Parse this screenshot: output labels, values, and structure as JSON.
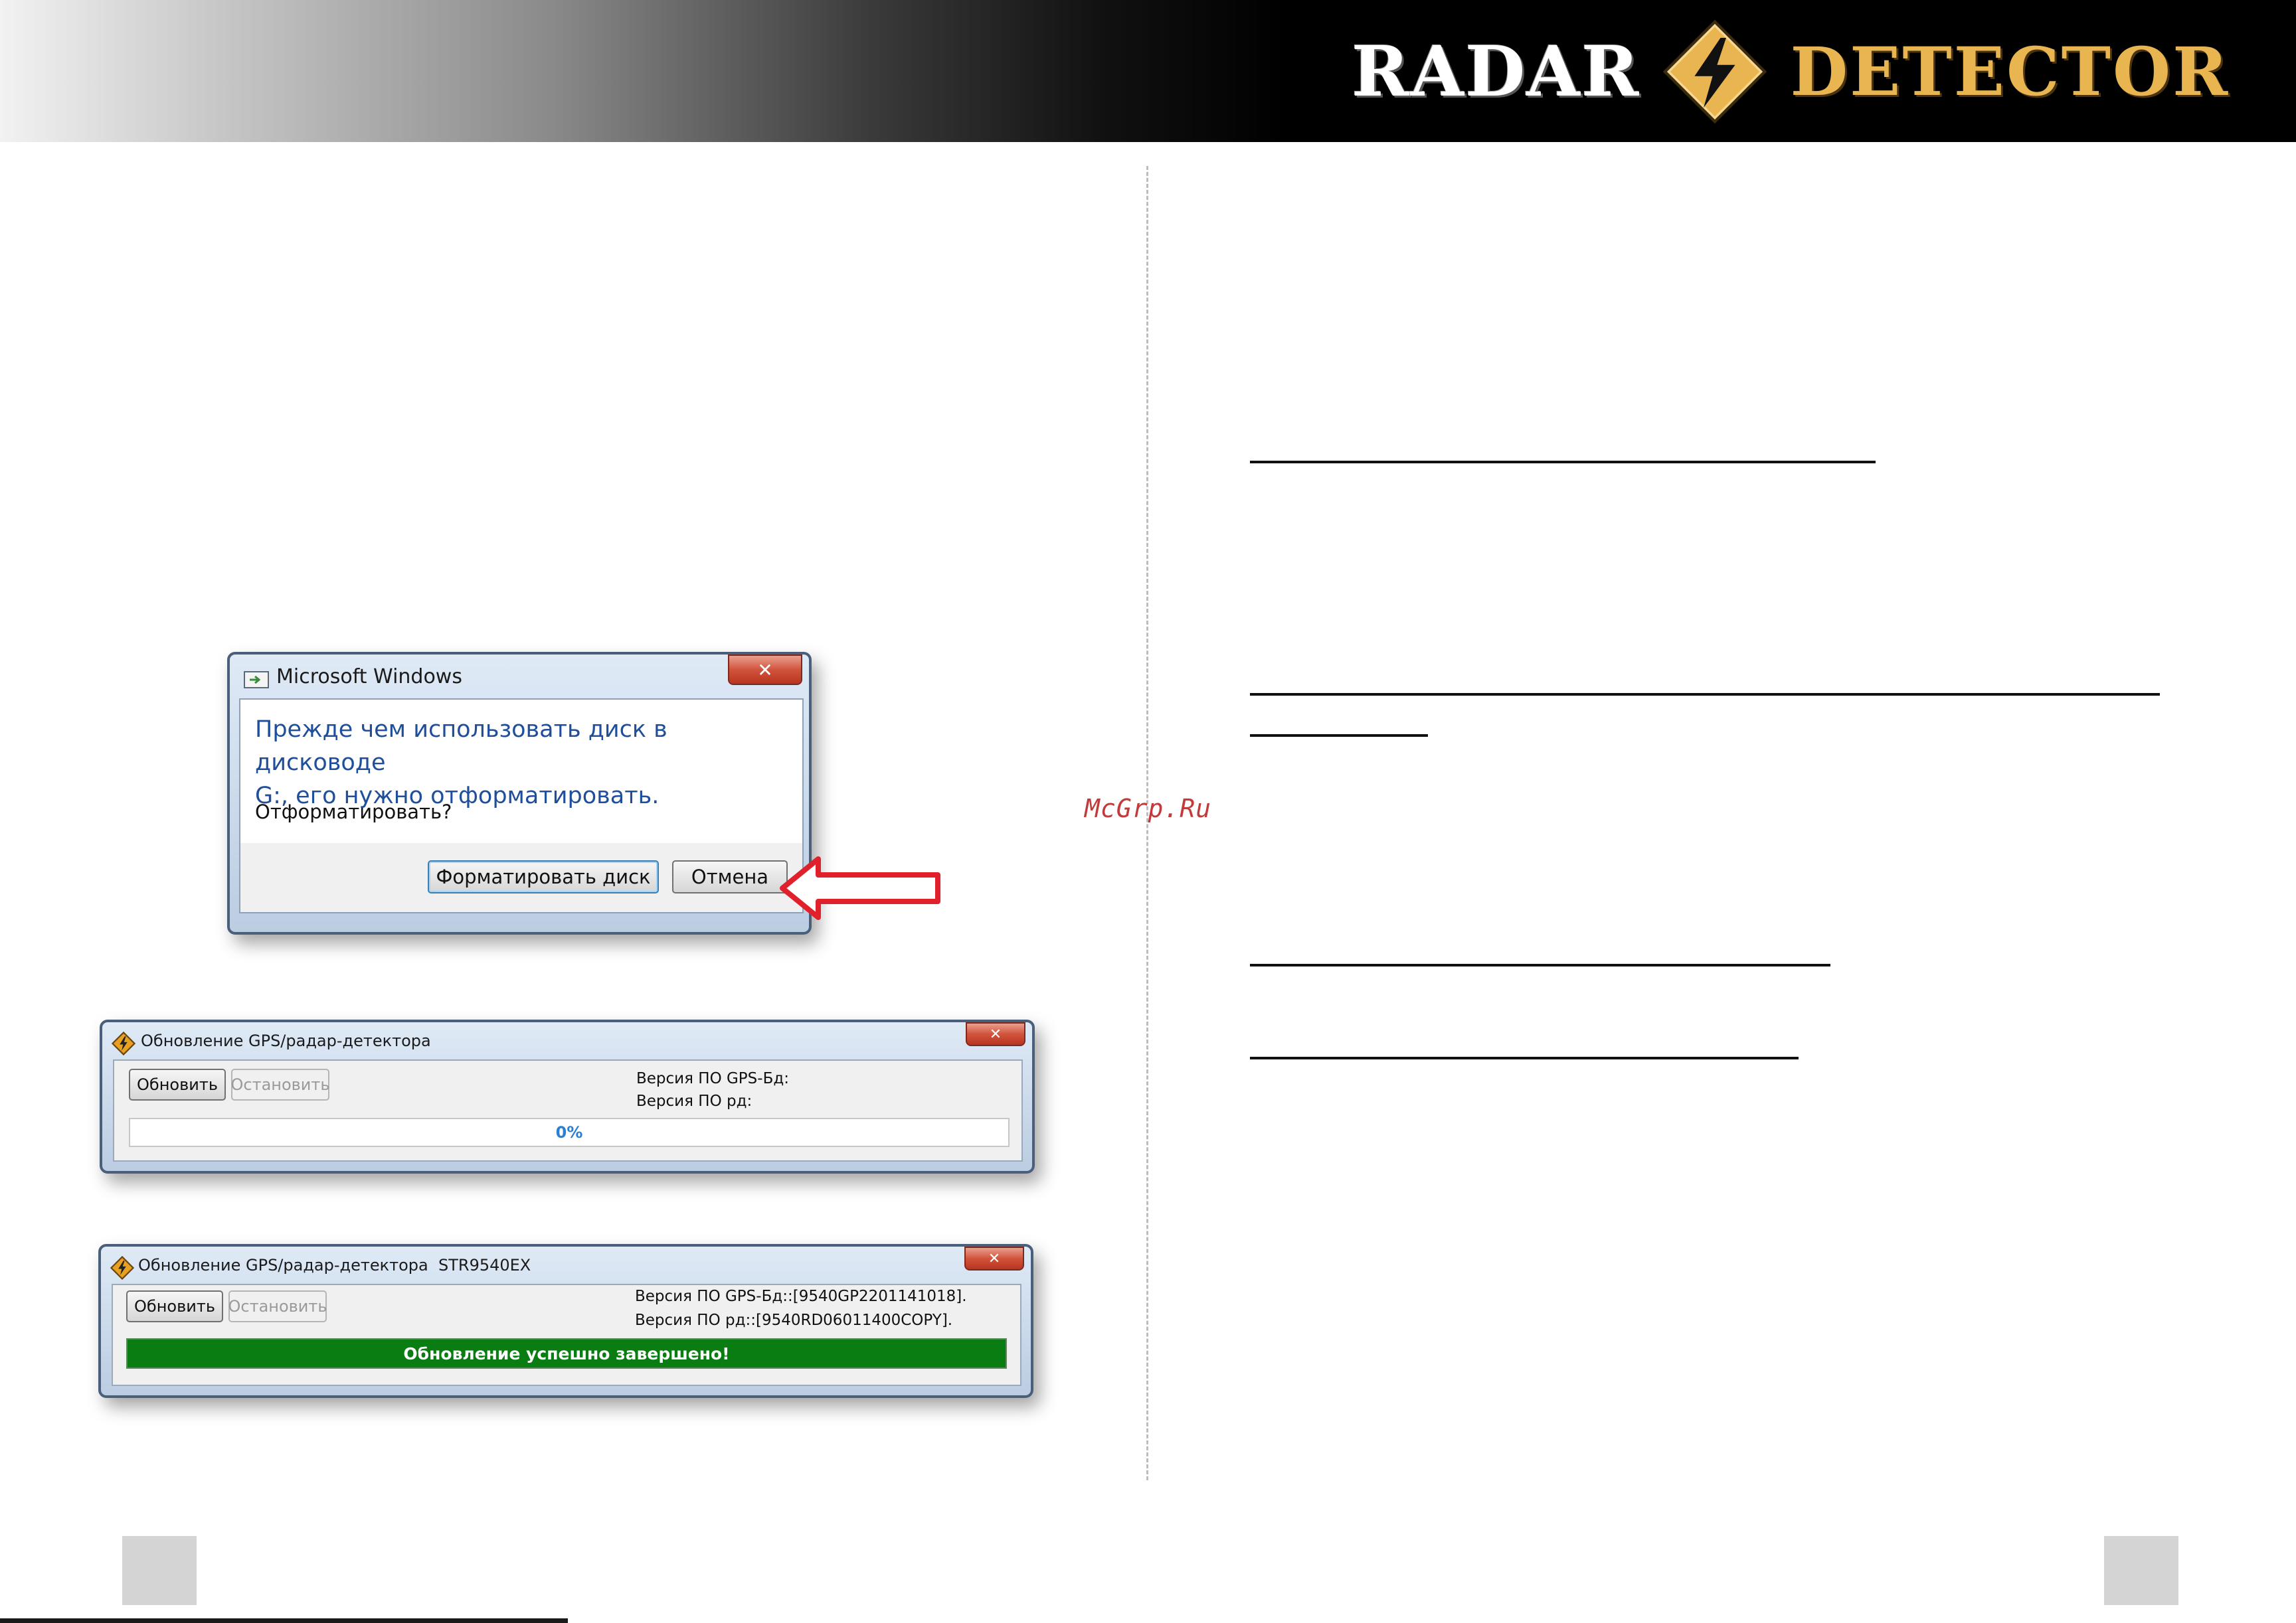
{
  "header": {
    "brand_left": "RADAR",
    "brand_right": "DETECTOR"
  },
  "watermark": "McGrp.Ru",
  "format_dialog": {
    "title": "Microsoft Windows",
    "message": "Прежде чем использовать диск в дисководе G:, его нужно отформатировать.",
    "message_line1": "Прежде чем использовать диск в дисководе",
    "message_line2": "G:, его нужно отформатировать.",
    "question": "Отформатировать?",
    "format_button": "Форматировать диск",
    "cancel_button": "Отмена",
    "close_glyph": "✕"
  },
  "update_dialog_1": {
    "title": "Обновление GPS/радар-детектора",
    "update_button": "Обновить",
    "stop_button": "Остановить",
    "gps_db_version": "Версия ПО GPS-Бд:",
    "rd_version": "Версия ПО рд:",
    "progress_text": "0%",
    "progress": 0,
    "close_glyph": "✕"
  },
  "update_dialog_2": {
    "title": "Обновление GPS/радар-детектора  STR9540EX",
    "update_button": "Обновить",
    "stop_button": "Остановить",
    "gps_db_version": "Версия ПО GPS-Бд::[9540GP2201141018].",
    "rd_version": "Версия ПО рд::[9540RD06011400COPY].",
    "progress_text": "Обновление успешно завершено!",
    "progress": 1,
    "close_glyph": "✕"
  },
  "colors": {
    "accent_gold": "#e8b550",
    "dialog_message_blue": "#1f4f9c",
    "progress_green": "#0a7d12",
    "arrow_red": "#e0202a"
  }
}
